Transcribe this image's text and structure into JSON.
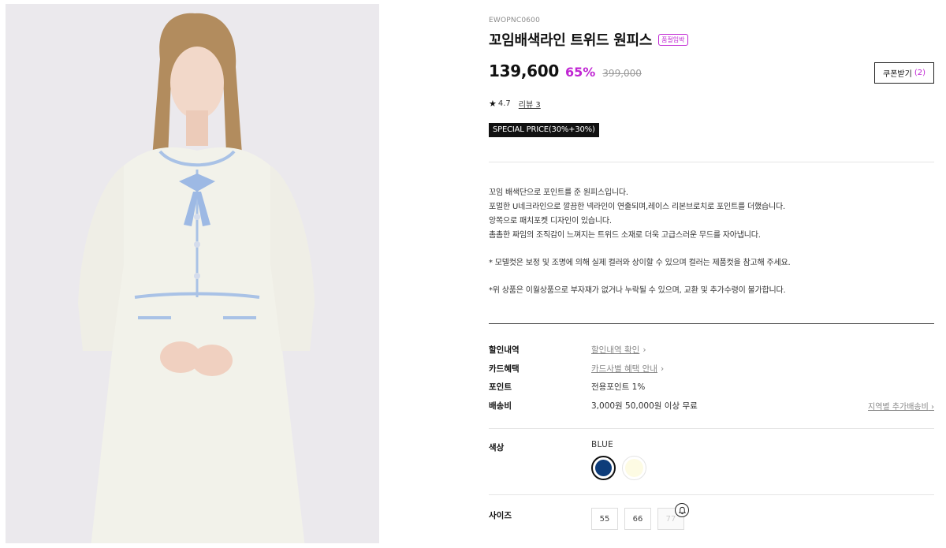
{
  "product": {
    "code": "EWOPNC0600",
    "title": "꼬임배색라인 트위드 원피스",
    "soldout_badge": "품절임박",
    "price": "139,600",
    "discount": "65%",
    "original_price": "399,000",
    "coupon_label": "쿠폰받기",
    "coupon_count": "(2)",
    "rating": "4.7",
    "review_label": "리뷰 3",
    "special_badge": "SPECIAL PRICE(30%+30%)"
  },
  "description": [
    "꼬임 배색단으로 포인트를 준 원피스입니다.",
    "포멀한 U네크라인으로 깔끔한 넥라인이 연출되며,레이스 리본브로치로 포인트를 더했습니다.",
    "앙쪽으로 패치포켓 디자인이 있습니다.",
    "촘촘한 짜임의 조직감이 느껴지는 트위드 소재로 더욱 고급스러운 무드를 자아냅니다.",
    "* 모델컷은 보정 및 조명에 의해 실제 컬러와 상이할 수 있으며 컬러는 제품컷을 참고해 주세요.",
    "*위 상품은 이월상품으로 부자재가 없거나 누락될 수 있으며, 교환 및 추가수령이 불가합니다."
  ],
  "benefits": {
    "discount_label": "할인내역",
    "discount_link": "할인내역 확인",
    "card_label": "카드혜택",
    "card_link": "카드사별 혜택 안내",
    "point_label": "포인트",
    "point_value": "전용포인트 1%",
    "shipping_label": "배송비",
    "shipping_value": "3,000원 50,000원 이상 무료",
    "shipping_link": "지역별 추가배송비"
  },
  "options": {
    "color_label": "색상",
    "selected_color": "BLUE",
    "colors": [
      {
        "name": "BLUE",
        "hex": "#0d3c7a"
      },
      {
        "name": "IVORY",
        "hex": "#fdfbe3"
      }
    ],
    "size_label": "사이즈",
    "sizes": [
      "55",
      "66",
      "77"
    ]
  },
  "colors": {
    "accent": "#c026d3",
    "dark": "#111111"
  }
}
